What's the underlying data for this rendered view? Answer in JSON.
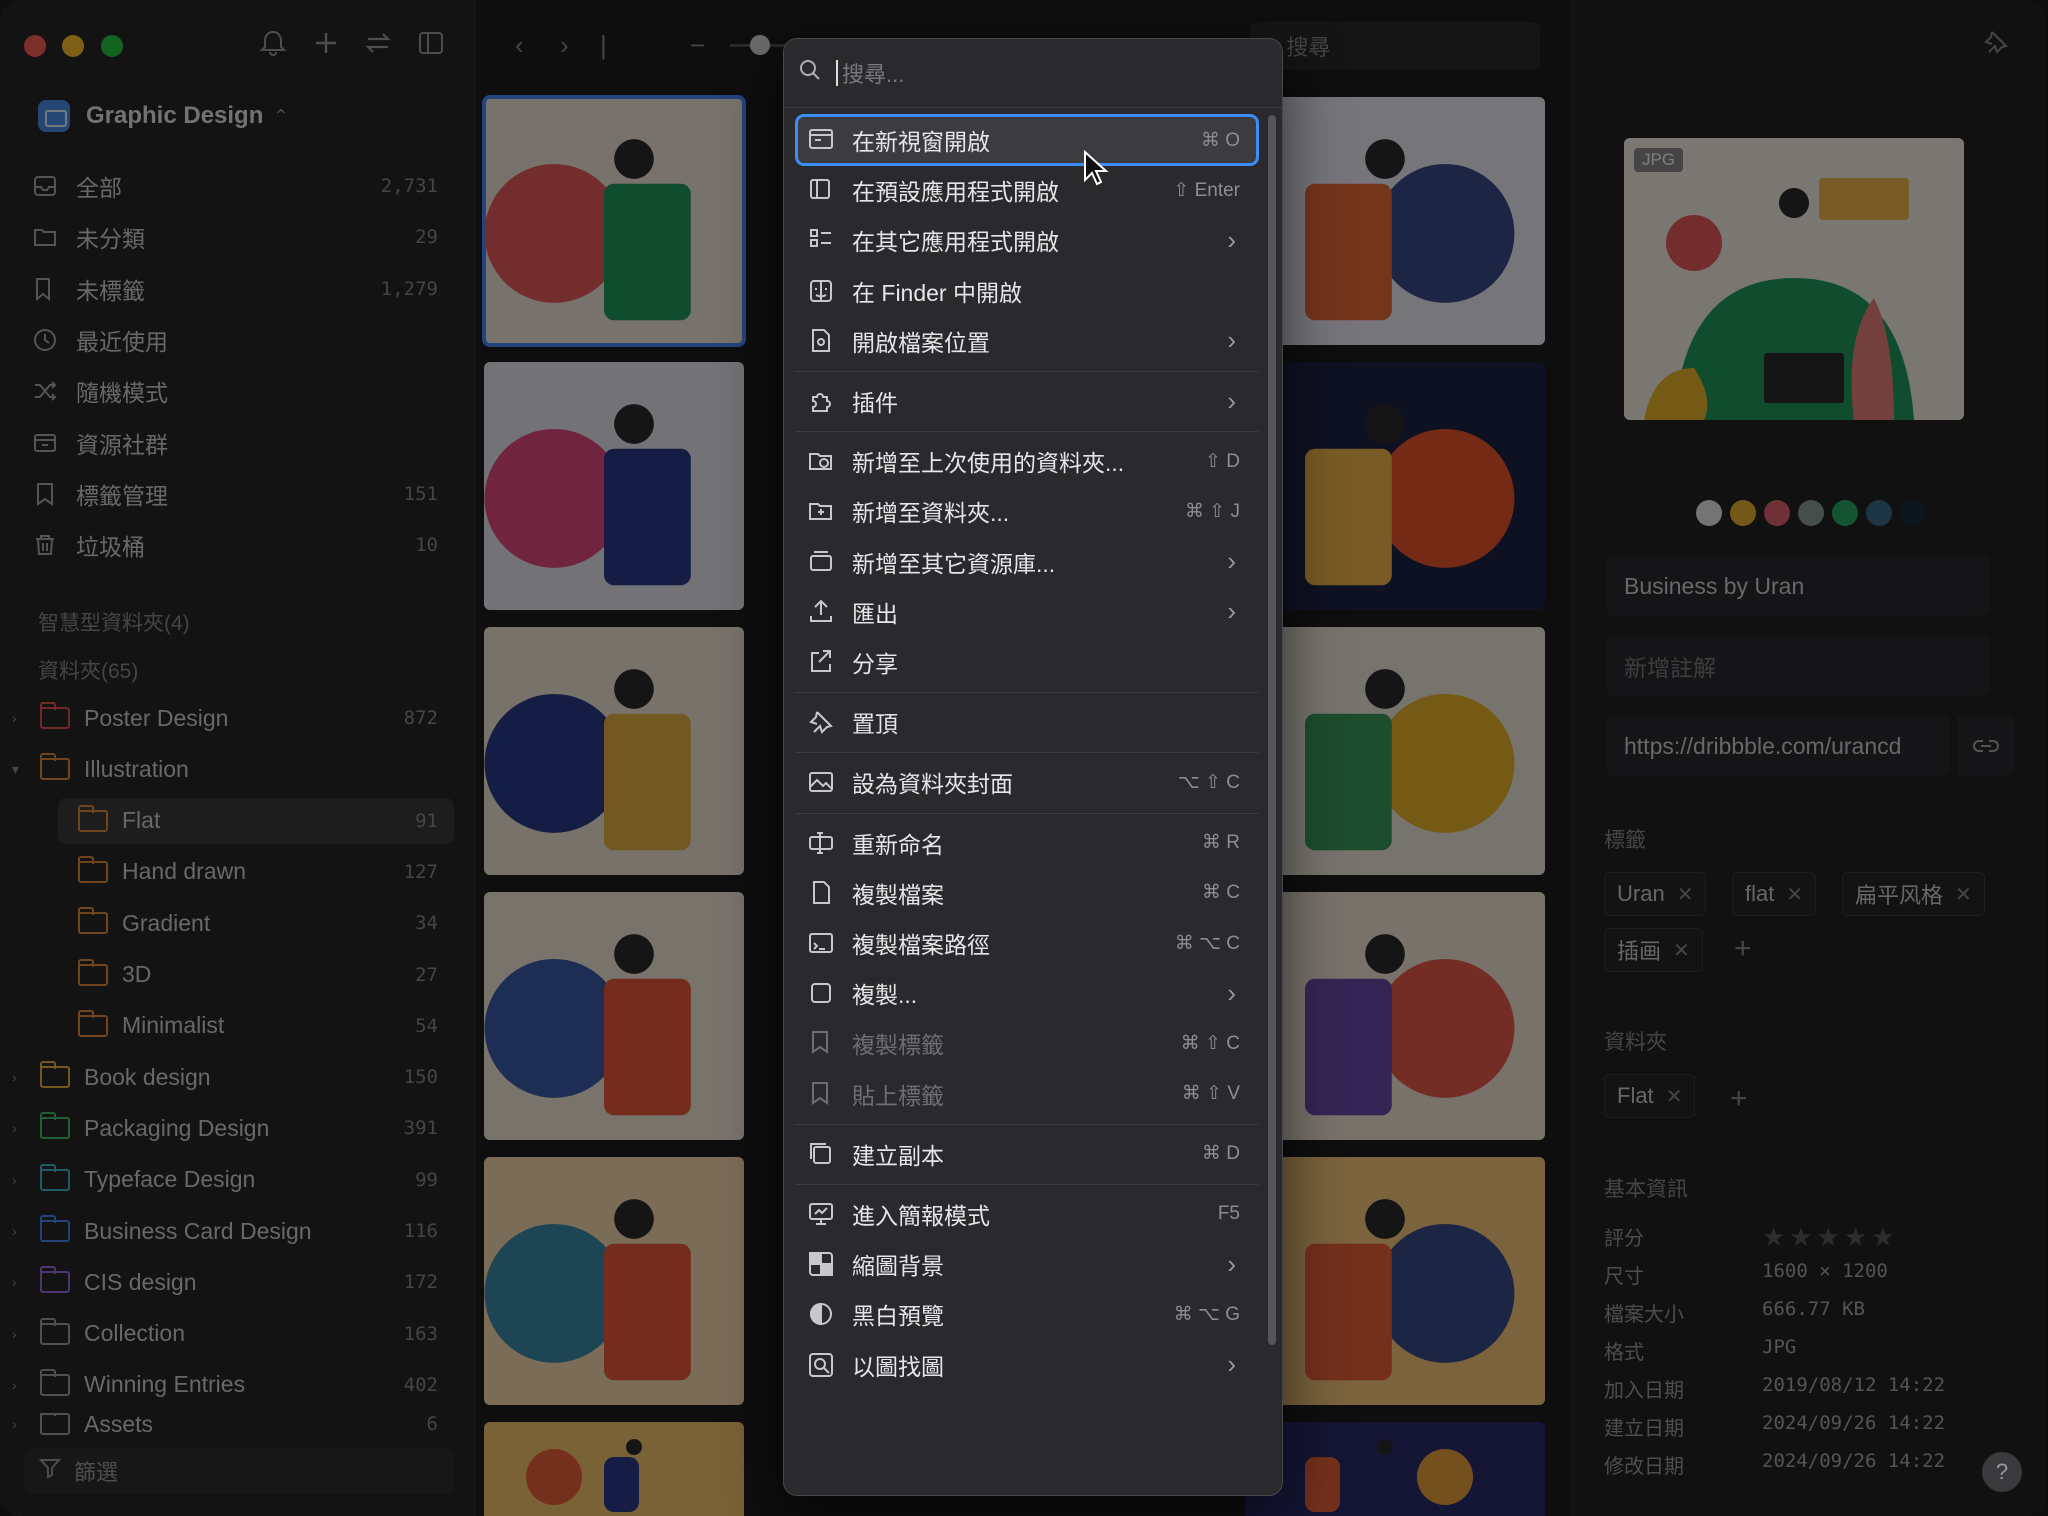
{
  "library": {
    "name": "Graphic Design"
  },
  "sidebar": {
    "items": [
      {
        "label": "全部",
        "count": "2,731",
        "icon": "inbox-icon"
      },
      {
        "label": "未分類",
        "count": "29",
        "icon": "unsorted-folder-icon"
      },
      {
        "label": "未標籤",
        "count": "1,279",
        "icon": "untagged-icon"
      },
      {
        "label": "最近使用",
        "count": "",
        "icon": "clock-icon"
      },
      {
        "label": "隨機模式",
        "count": "",
        "icon": "shuffle-icon"
      },
      {
        "label": "資源社群",
        "count": "",
        "icon": "community-icon"
      },
      {
        "label": "標籤管理",
        "count": "151",
        "icon": "bookmark-icon"
      },
      {
        "label": "垃圾桶",
        "count": "10",
        "icon": "trash-icon"
      }
    ],
    "smart_folders_label": "智慧型資料夾(4)",
    "folders_label": "資料夾(65)",
    "folders": [
      {
        "label": "Poster Design",
        "count": "872",
        "color": "#e0505a",
        "expanded": false
      },
      {
        "label": "Illustration",
        "count": "",
        "color": "#e08a3c",
        "expanded": true
      },
      {
        "label": "Flat",
        "count": "91",
        "color": "#e08a3c",
        "sub": true,
        "selected": true
      },
      {
        "label": "Hand drawn",
        "count": "127",
        "color": "#e08a3c",
        "sub": true
      },
      {
        "label": "Gradient",
        "count": "34",
        "color": "#e08a3c",
        "sub": true
      },
      {
        "label": "3D",
        "count": "27",
        "color": "#e08a3c",
        "sub": true
      },
      {
        "label": "Minimalist",
        "count": "54",
        "color": "#e08a3c",
        "sub": true
      },
      {
        "label": "Book design",
        "count": "150",
        "color": "#e8b23c",
        "expanded": false
      },
      {
        "label": "Packaging Design",
        "count": "391",
        "color": "#3fbf6a",
        "expanded": false
      },
      {
        "label": "Typeface Design",
        "count": "99",
        "color": "#3fb8c8",
        "expanded": false
      },
      {
        "label": "Business Card Design",
        "count": "116",
        "color": "#4a86e8",
        "expanded": false
      },
      {
        "label": "CIS design",
        "count": "172",
        "color": "#9a6ae0",
        "expanded": false
      },
      {
        "label": "Collection",
        "count": "163",
        "color": "#a0a0a4",
        "expanded": false
      },
      {
        "label": "Winning Entries",
        "count": "402",
        "color": "#a0a0a4",
        "expanded": false
      },
      {
        "label": "Assets",
        "count": "6",
        "color": "#a0a0a4",
        "expanded": false
      }
    ],
    "filter_label": "篩選"
  },
  "toolbar": {
    "search_placeholder": "搜尋"
  },
  "context_menu": {
    "search_placeholder": "搜尋...",
    "items": [
      {
        "label": "在新視窗開啟",
        "shortcut": "⌘ O",
        "icon": "new-window-icon",
        "highlighted": true
      },
      {
        "label": "在預設應用程式開啟",
        "shortcut": "⇧ Enter",
        "icon": "open-app-icon"
      },
      {
        "label": "在其它應用程式開啟",
        "submenu": true,
        "icon": "app-list-icon"
      },
      {
        "label": "在 Finder 中開啟",
        "icon": "finder-icon"
      },
      {
        "label": "開啟檔案位置",
        "submenu": true,
        "icon": "file-location-icon"
      },
      {
        "label": "插件",
        "submenu": true,
        "icon": "plugin-icon",
        "sep_before": true
      },
      {
        "label": "新增至上次使用的資料夾...",
        "shortcut": "⇧ D",
        "icon": "folder-recent-icon",
        "sep_before": true
      },
      {
        "label": "新增至資料夾...",
        "shortcut": "⌘ ⇧ J",
        "icon": "folder-add-icon"
      },
      {
        "label": "新增至其它資源庫...",
        "submenu": true,
        "icon": "library-add-icon"
      },
      {
        "label": "匯出",
        "submenu": true,
        "icon": "export-icon"
      },
      {
        "label": "分享",
        "icon": "share-icon"
      },
      {
        "label": "置頂",
        "icon": "pin-icon",
        "sep_before": true
      },
      {
        "label": "設為資料夾封面",
        "shortcut": "⌥ ⇧ C",
        "icon": "cover-image-icon",
        "sep_before": true
      },
      {
        "label": "重新命名",
        "shortcut": "⌘ R",
        "icon": "rename-icon",
        "sep_before": true
      },
      {
        "label": "複製檔案",
        "shortcut": "⌘ C",
        "icon": "copy-file-icon"
      },
      {
        "label": "複製檔案路徑",
        "shortcut": "⌘ ⌥ C",
        "icon": "copy-path-icon"
      },
      {
        "label": "複製...",
        "submenu": true,
        "icon": "copy-icon"
      },
      {
        "label": "複製標籤",
        "shortcut": "⌘ ⇧ C",
        "icon": "copy-tags-icon",
        "disabled": true
      },
      {
        "label": "貼上標籤",
        "shortcut": "⌘ ⇧ V",
        "icon": "paste-tags-icon",
        "disabled": true
      },
      {
        "label": "建立副本",
        "shortcut": "⌘ D",
        "icon": "duplicate-icon",
        "sep_before": true
      },
      {
        "label": "進入簡報模式",
        "shortcut": "F5",
        "icon": "presentation-icon",
        "sep_before": true
      },
      {
        "label": "縮圖背景",
        "submenu": true,
        "icon": "checker-bg-icon"
      },
      {
        "label": "黑白預覽",
        "shortcut": "⌘ ⌥ G",
        "icon": "grayscale-icon"
      },
      {
        "label": "以圖找圖",
        "submenu": true,
        "icon": "image-search-icon"
      }
    ]
  },
  "inspector": {
    "badge": "JPG",
    "palette": [
      "#e8e8e8",
      "#e8b030",
      "#e06070",
      "#8a9a9a",
      "#2aa860",
      "#3a6a8a",
      "#1a2a3a"
    ],
    "title": "Business by Uran",
    "note_placeholder": "新增註解",
    "url": "https://dribbble.com/urancd",
    "tags_label": "標籤",
    "tags": [
      "Uran",
      "flat",
      "扁平风格",
      "插画"
    ],
    "folders_label": "資料夾",
    "folders": [
      "Flat"
    ],
    "basic_info_label": "基本資訊",
    "info": [
      {
        "key": "評分",
        "value": ""
      },
      {
        "key": "尺寸",
        "value": "1600 × 1200"
      },
      {
        "key": "檔案大小",
        "value": "666.77 KB"
      },
      {
        "key": "格式",
        "value": "JPG"
      },
      {
        "key": "加入日期",
        "value": "2019/08/12 14:22"
      },
      {
        "key": "建立日期",
        "value": "2024/09/26 14:22"
      },
      {
        "key": "修改日期",
        "value": "2024/09/26 14:22"
      }
    ],
    "rating": 0
  },
  "thumbnails": [
    {
      "bg": "#f1e4d8",
      "accent": "#e85a5a",
      "second": "#1f9a5c"
    },
    {
      "bg": "#eceaf2",
      "accent": "#3a4a8a",
      "second": "#e86a3a"
    },
    {
      "bg": "#e6e4ec",
      "accent": "#e0487a",
      "second": "#2a3a8a"
    },
    {
      "bg": "#1c2244",
      "accent": "#e8552a",
      "second": "#f2b84a"
    },
    {
      "bg": "#efe4d4",
      "accent": "#2a3a8a",
      "second": "#e8b042"
    },
    {
      "bg": "#eee8dc",
      "accent": "#e8b42a",
      "second": "#3a9a5a"
    },
    {
      "bg": "#f0e6d6",
      "accent": "#3a5aa8",
      "second": "#e85a3a"
    },
    {
      "bg": "#f0e4d6",
      "accent": "#e85a4a",
      "second": "#6a4aa8"
    },
    {
      "bg": "#f7d9b0",
      "accent": "#3a8aa8",
      "second": "#e85a3a"
    },
    {
      "bg": "#f4c67a",
      "accent": "#3a4a8a",
      "second": "#e8603a"
    },
    {
      "bg": "#f2c46a",
      "accent": "#e8603a",
      "second": "#2a3a8a"
    },
    {
      "bg": "#2a2a6a",
      "accent": "#e8a03a",
      "second": "#e8603a"
    }
  ]
}
